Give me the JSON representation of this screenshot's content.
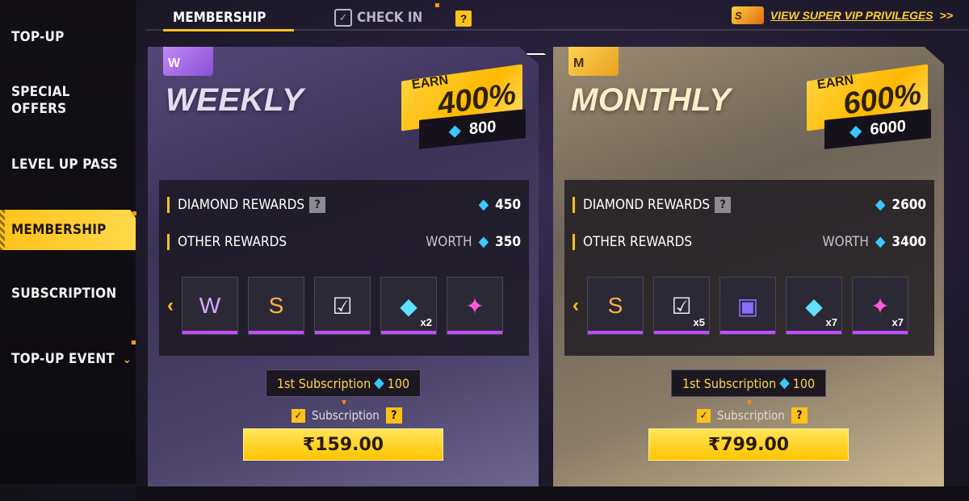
{
  "sidebar": {
    "items": [
      {
        "label": "TOP-UP"
      },
      {
        "label": "SPECIAL\nOFFERS"
      },
      {
        "label": "LEVEL UP PASS"
      },
      {
        "label": "MEMBERSHIP"
      },
      {
        "label": "SUBSCRIPTION"
      },
      {
        "label": "TOP-UP EVENT"
      }
    ],
    "active_index": 3
  },
  "tabs": {
    "membership": "MEMBERSHIP",
    "checkin": "CHECK IN",
    "help": "?"
  },
  "vip": {
    "badge": "S",
    "link": "VIEW SUPER VIP PRIVILEGES",
    "chevron": ">>"
  },
  "weekly": {
    "badge": "W",
    "title": "WEEKLY",
    "earn_label": "EARN",
    "earn_pct": "400%",
    "earn_diamonds": "800",
    "diamond_rewards_label": "DIAMOND REWARDS",
    "diamond_rewards_value": "450",
    "other_rewards_label": "OTHER REWARDS",
    "worth_label": "WORTH",
    "other_rewards_value": "350",
    "items": [
      {
        "name": "weekly-card-item",
        "glyph": "W",
        "qty": ""
      },
      {
        "name": "vip-card-item",
        "glyph": "S",
        "qty": ""
      },
      {
        "name": "checkin-card-item",
        "glyph": "☑",
        "qty": ""
      },
      {
        "name": "diamond-voucher-item",
        "glyph": "◆",
        "qty": "x2"
      },
      {
        "name": "weapon-voucher-item",
        "glyph": "✦",
        "qty": ""
      }
    ],
    "first_sub_label": "1st Subscription",
    "first_sub_value": "100",
    "subscription_label": "Subscription",
    "price": "₹159.00"
  },
  "monthly": {
    "badge": "M",
    "title": "MONTHLY",
    "earn_label": "EARN",
    "earn_pct": "600%",
    "earn_diamonds": "6000",
    "diamond_rewards_label": "DIAMOND REWARDS",
    "diamond_rewards_value": "2600",
    "other_rewards_label": "OTHER REWARDS",
    "worth_label": "WORTH",
    "other_rewards_value": "3400",
    "items": [
      {
        "name": "vip-card-item",
        "glyph": "S",
        "qty": ""
      },
      {
        "name": "checkin-card-item",
        "glyph": "☑",
        "qty": "x5"
      },
      {
        "name": "bundle-item",
        "glyph": "▣",
        "qty": ""
      },
      {
        "name": "diamond-voucher-item",
        "glyph": "◆",
        "qty": "x7"
      },
      {
        "name": "weapon-voucher-item",
        "glyph": "✦",
        "qty": "x7"
      }
    ],
    "first_sub_label": "1st Subscription",
    "first_sub_value": "100",
    "subscription_label": "Subscription",
    "price": "₹799.00"
  },
  "colors": {
    "accent": "#ffc21a",
    "diamond": "#38c8ff",
    "item_bar": "#c24cff"
  }
}
